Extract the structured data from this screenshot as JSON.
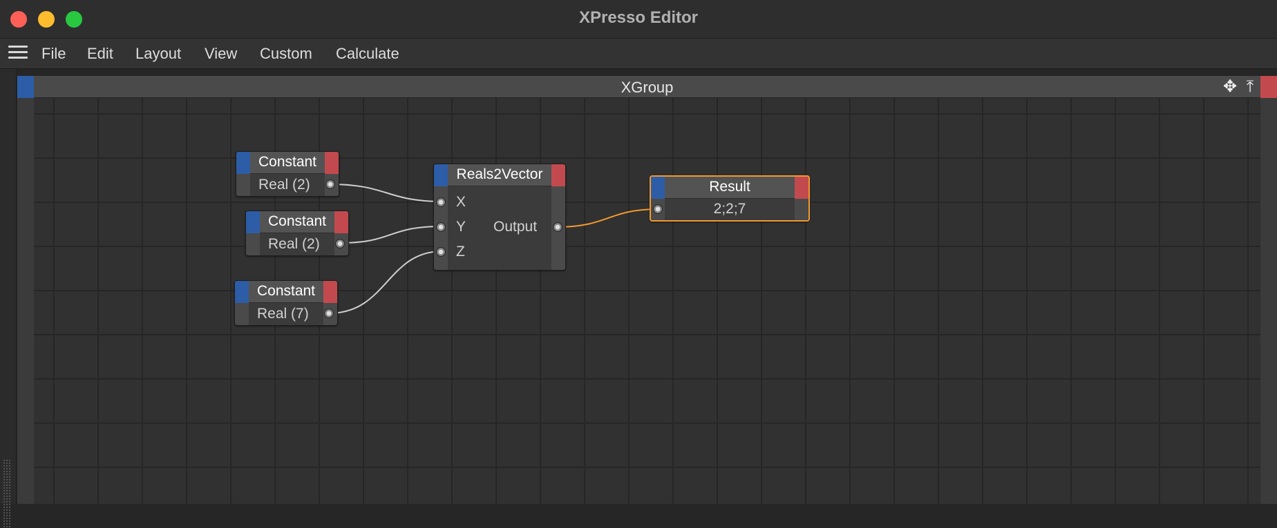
{
  "window": {
    "title": "XPresso Editor"
  },
  "menu": {
    "items": [
      "File",
      "Edit",
      "Layout",
      "View",
      "Custom",
      "Calculate"
    ]
  },
  "group": {
    "title": "XGroup"
  },
  "icons": {
    "menu": "hamburger-icon",
    "move": "move-arrows-icon",
    "fit": "fit-arrow-icon"
  },
  "nodes": {
    "constant1": {
      "title": "Constant",
      "port": "Real (2)"
    },
    "constant2": {
      "title": "Constant",
      "port": "Real (2)"
    },
    "constant3": {
      "title": "Constant",
      "port": "Real (7)"
    },
    "reals2vector": {
      "title": "Reals2Vector",
      "inputs": [
        "X",
        "Y",
        "Z"
      ],
      "output": "Output"
    },
    "result": {
      "title": "Result",
      "value": "2;2;7"
    }
  },
  "colors": {
    "node_input_bar": "#2d5da6",
    "node_output_bar": "#c24a4e",
    "selected_outline": "#f29a2e",
    "wire": "#cfcfcf",
    "wire_selected": "#f29a2e"
  }
}
